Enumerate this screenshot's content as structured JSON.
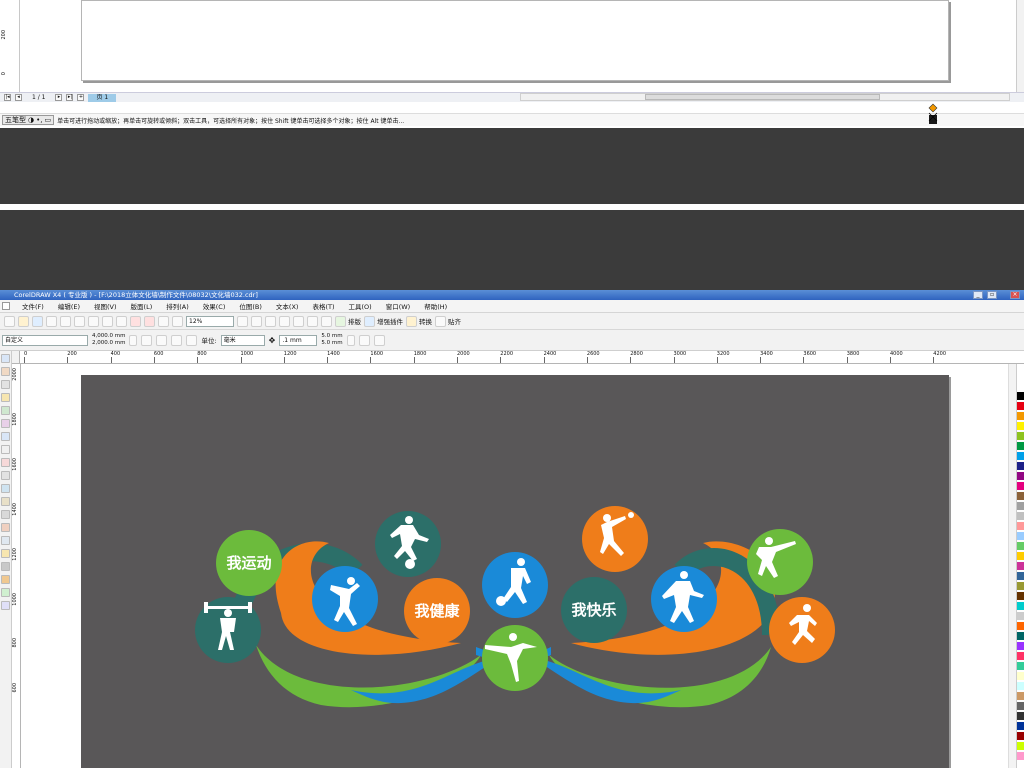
{
  "top_window": {
    "page_counter": "1 / 1",
    "page_tab": "页 1",
    "ime_label": "五笔型",
    "status_hint": "单击可进行拖动或缩放；再单击可旋转或倾斜；双击工具，可选择所有对象；按住 Shift 键单击可选择多个对象；按住 Alt 键单击..."
  },
  "app": {
    "title": "CorelDRAW X4 ( 专业版 ) - [F:\\2018立体文化墙\\制作文件\\08032\\文化墙032.cdr]"
  },
  "menu": [
    "文件(F)",
    "编辑(E)",
    "视图(V)",
    "版面(L)",
    "排列(A)",
    "效果(C)",
    "位图(B)",
    "文本(X)",
    "表格(T)",
    "工具(O)",
    "窗口(W)",
    "帮助(H)"
  ],
  "toolbar": {
    "zoom": "12%",
    "arrange_label": "排版",
    "plugin_label": "增强插件",
    "convert_label": "转换",
    "paste_label": "贴齐"
  },
  "property_bar": {
    "preset": "自定义",
    "width": "4,000.0 mm",
    "height": "2,000.0 mm",
    "unit_label": "单位:",
    "unit": "毫米",
    "nudge": ".1 mm",
    "dup_x": "5.0 mm",
    "dup_y": "5.0 mm"
  },
  "hruler_ticks": [
    "0",
    "200",
    "400",
    "600",
    "800",
    "1000",
    "1200",
    "1400",
    "1600",
    "1800",
    "2000",
    "2200",
    "2400",
    "2600",
    "2800",
    "3000",
    "3200",
    "3400",
    "3600",
    "3800",
    "4000",
    "4200"
  ],
  "vruler_ticks": [
    "2000",
    "1800",
    "1600",
    "1400",
    "1200",
    "1000",
    "800",
    "600"
  ],
  "top_vruler_ticks": [
    "200",
    "0"
  ],
  "artwork": {
    "labels": [
      "我运动",
      "我健康",
      "我快乐"
    ],
    "colors": {
      "green": "#6cbb3c",
      "orange": "#ef7d1a",
      "teal": "#2c6f69",
      "blue": "#1a8ad8",
      "board": "#595758"
    },
    "icons": [
      "weightlifter-icon",
      "dancer-icon",
      "footballer-icon",
      "basketball-icon",
      "ballerina-icon",
      "volleyball-icon",
      "table-tennis-icon",
      "martial-arts-icon",
      "runner-icon"
    ]
  },
  "palette_colors": [
    "#ffffff",
    "#000000",
    "#e60012",
    "#f39800",
    "#fff100",
    "#8fc31f",
    "#009944",
    "#00a0e9",
    "#1d2088",
    "#920783",
    "#e4007f",
    "#8c6239",
    "#a0a0a0",
    "#c0c0c0",
    "#ff9999",
    "#99ccff",
    "#66cc66",
    "#ffcc00",
    "#cc3399",
    "#336699",
    "#999933",
    "#663300",
    "#00cccc",
    "#cccccc",
    "#ff6600",
    "#006666",
    "#9933ff",
    "#ff3366",
    "#33cc99",
    "#ffffcc",
    "#ccffff",
    "#cc9966",
    "#666666",
    "#333333",
    "#003399",
    "#990000",
    "#ccff00",
    "#ff99cc"
  ]
}
